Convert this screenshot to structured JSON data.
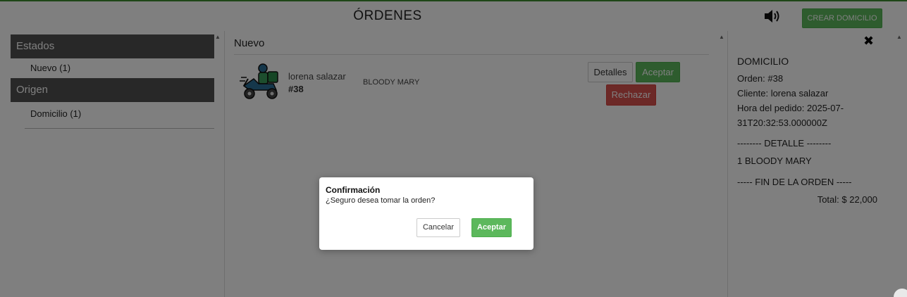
{
  "header": {
    "title": "ÓRDENES",
    "create_button": "CREAR DOMICILIO",
    "sound_icon": "speaker-icon"
  },
  "sidebar": {
    "sections": [
      {
        "label": "Estados",
        "items": [
          {
            "label": "Nuevo (1)"
          }
        ]
      },
      {
        "label": "Origen",
        "items": [
          {
            "label": "Domicilio (1)"
          }
        ]
      }
    ]
  },
  "main": {
    "section_title": "Nuevo",
    "order": {
      "icon": "delivery-scooter-icon",
      "customer": "lorena salazar",
      "number": "#38",
      "product": "BLOODY MARY",
      "details_button": "Detalles",
      "accept_button": "Aceptar",
      "reject_button": "Rechazar"
    }
  },
  "detail_panel": {
    "close_icon": "close-icon",
    "title": "DOMICILIO",
    "order_line": "Orden: #38",
    "client_line": "Cliente: lorena salazar",
    "time_line": "Hora del pedido: 2025-07-31T20:32:53.000000Z",
    "detail_divider": "-------- DETALLE --------",
    "item_line": "1   BLOODY MARY",
    "end_divider": "----- FIN DE LA ORDEN -----",
    "total": "Total: $ 22,000"
  },
  "modal": {
    "title": "Confirmación",
    "message": "¿Seguro desea tomar la orden?",
    "cancel_button": "Cancelar",
    "accept_button": "Aceptar"
  },
  "colors": {
    "accent_green": "#5cb85c",
    "danger_red": "#d9534f",
    "sidebar_section_bg": "#505050"
  }
}
